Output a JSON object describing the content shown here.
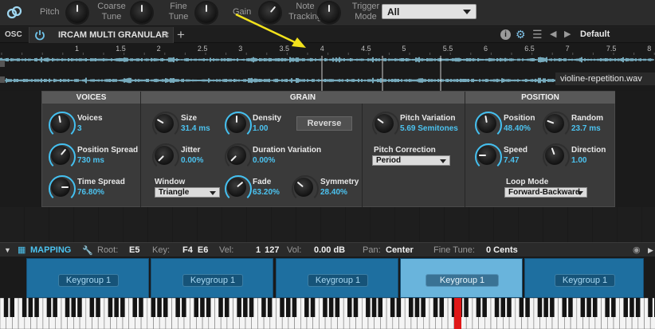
{
  "top": {
    "params": [
      {
        "label": "Pitch"
      },
      {
        "label": "Coarse\nTune"
      },
      {
        "label": "Fine\nTune"
      },
      {
        "label": "Gain"
      },
      {
        "label": "Note\nTracking"
      },
      {
        "label": "Trigger\nMode"
      }
    ],
    "trigger_mode": "All"
  },
  "tabs": {
    "osc_label": "OSC",
    "active_tab": "IRCAM MULTI GRANULAR",
    "preset": "Default"
  },
  "waveform": {
    "ruler": [
      "1",
      "1.5",
      "2",
      "2.5",
      "3",
      "3.5",
      "4",
      "4.5",
      "5",
      "5.5",
      "6",
      "6.5",
      "7",
      "7.5",
      "8"
    ],
    "file_name": "violine-repetition.wav",
    "wave_color": "#8ecfe6"
  },
  "sections": {
    "voices": "VOICES",
    "grain": "GRAIN",
    "position": "POSITION"
  },
  "voices": {
    "voices": {
      "name": "Voices",
      "value": "3"
    },
    "position_spread": {
      "name": "Position Spread",
      "value": "730 ms"
    },
    "time_spread": {
      "name": "Time Spread",
      "value": "76.80%"
    }
  },
  "grain": {
    "size": {
      "name": "Size",
      "value": "31.4 ms"
    },
    "density": {
      "name": "Density",
      "value": "1.00"
    },
    "reverse": "Reverse",
    "jitter": {
      "name": "Jitter",
      "value": "0.00%"
    },
    "duration_variation": {
      "name": "Duration Variation",
      "value": "0.00%"
    },
    "window": {
      "name": "Window",
      "value": "Triangle"
    },
    "fade": {
      "name": "Fade",
      "value": "63.20%"
    },
    "symmetry": {
      "name": "Symmetry",
      "value": "28.40%"
    },
    "pitch_variation": {
      "name": "Pitch Variation",
      "value": "5.69 Semitones"
    },
    "pitch_correction": {
      "name": "Pitch Correction",
      "value": "Period"
    }
  },
  "position": {
    "position": {
      "name": "Position",
      "value": "48.40%"
    },
    "random": {
      "name": "Random",
      "value": "23.7 ms"
    },
    "speed": {
      "name": "Speed",
      "value": "7.47"
    },
    "direction": {
      "name": "Direction",
      "value": "1.00"
    },
    "loop_mode": {
      "name": "Loop Mode",
      "value": "Forward-Backward"
    }
  },
  "mapping": {
    "title": "MAPPING",
    "root_label": "Root:",
    "root": "E5",
    "key_label": "Key:",
    "key": "F4  E6",
    "vel_label": "Vel:",
    "vel": "1  127",
    "vol_label": "Vol:",
    "vol": "0.00 dB",
    "pan_label": "Pan:",
    "pan": "Center",
    "fine_label": "Fine Tune:",
    "fine": "0 Cents"
  },
  "keygroups": [
    {
      "label": "Keygroup 1",
      "selected": false
    },
    {
      "label": "Keygroup 1",
      "selected": false
    },
    {
      "label": "Keygroup 1",
      "selected": false
    },
    {
      "label": "Keygroup 1",
      "selected": true
    },
    {
      "label": "Keygroup 1",
      "selected": false
    }
  ],
  "colors": {
    "accent": "#44c0f0",
    "value_text": "#4cc3f0",
    "keygroup": "#1e6fa0",
    "keygroup_selected": "#69b4dc",
    "pressed_key": "#e01818",
    "annotation": "#f2e21c"
  }
}
